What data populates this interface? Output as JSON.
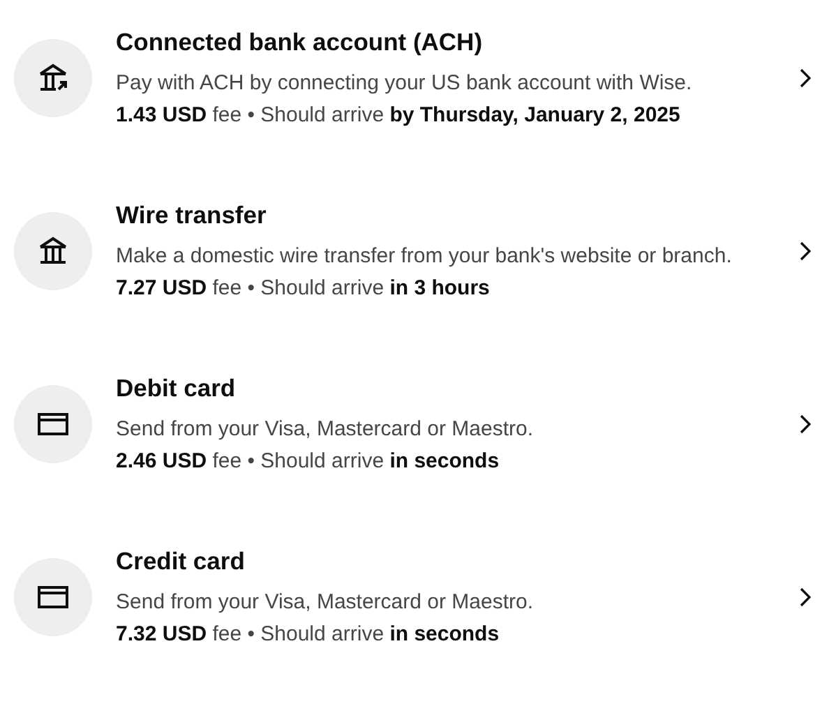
{
  "payment_methods": [
    {
      "kind": "bank-link",
      "title": "Connected bank account (ACH)",
      "description": "Pay with ACH by connecting your US bank account with Wise.",
      "fee": "**1.43 USD** fee • Should arrive **by Thursday, January 2, 2025**"
    },
    {
      "kind": "bank",
      "title": "Wire transfer",
      "description": "Make a domestic wire transfer from your bank's website or branch.",
      "fee": "**7.27 USD** fee • Should arrive **in 3 hours**"
    },
    {
      "kind": "card",
      "title": "Debit card",
      "description": "Send from your Visa, Mastercard or Maestro.",
      "fee": "**2.46 USD** fee • Should arrive **in seconds**"
    },
    {
      "kind": "card",
      "title": "Credit card",
      "description": "Send from your Visa, Mastercard or Maestro.",
      "fee": "**7.32 USD** fee • Should arrive **in seconds**"
    }
  ]
}
